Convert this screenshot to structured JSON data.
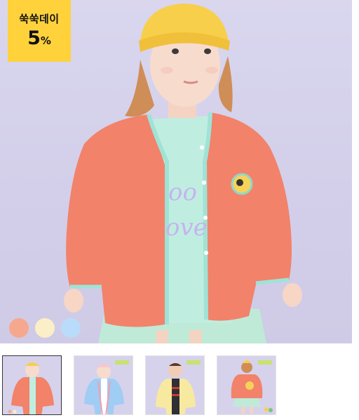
{
  "badge": {
    "line1": "쑥쑥데이",
    "number": "5",
    "unit": "%"
  },
  "swatches": [
    {
      "name": "coral",
      "color": "#f6a88f"
    },
    {
      "name": "cream",
      "color": "#fbefc8"
    },
    {
      "name": "sky",
      "color": "#b9dcfb"
    }
  ],
  "thumbnails": [
    {
      "name": "thumbnail-coral-jacket",
      "active": true
    },
    {
      "name": "thumbnail-blue-jacket",
      "active": false
    },
    {
      "name": "thumbnail-yellow-jacket",
      "active": false
    },
    {
      "name": "thumbnail-back-view",
      "active": false
    }
  ],
  "colors": {
    "background": "#d6d2ec",
    "badge": "#ffd23c",
    "jacket_coral": "#f2826a",
    "trim_mint": "#9fe3d6",
    "hat_yellow": "#f7cf4a"
  }
}
